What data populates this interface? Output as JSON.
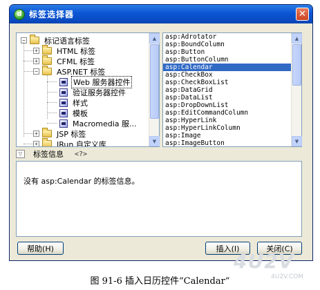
{
  "window": {
    "title": "标签选择器",
    "close_glyph": "✕",
    "app_icon_glyph": "d"
  },
  "tree": {
    "root_label": "标记语言标签",
    "nodes": [
      {
        "label": "HTML 标签",
        "expander": "+"
      },
      {
        "label": "CFML 标签",
        "expander": "+"
      },
      {
        "label": "ASP.NET 标签",
        "expander": "−"
      },
      {
        "label": "Web 服务器控件",
        "selected": true
      },
      {
        "label": "验证服务器控件"
      },
      {
        "label": "样式"
      },
      {
        "label": "模板"
      },
      {
        "label": "Macromedia 服..."
      },
      {
        "label": "JSP 标签",
        "expander": "+"
      },
      {
        "label": "JRun 自定义库",
        "expander": "+"
      }
    ]
  },
  "tag_list": {
    "items": [
      "asp:Adrotator",
      "asp:BoundColumn",
      "asp:Button",
      "asp:ButtonColumn",
      "asp:Calendar",
      "asp:CheckBox",
      "asp:CheckBoxList",
      "asp:DataGrid",
      "asp:DataList",
      "asp:DropDownList",
      "asp:EditCommandColumn",
      "asp:HyperLink",
      "asp:HyperLinkColumn",
      "asp:Image",
      "asp:ImageButton"
    ],
    "selected": "asp:Calendar"
  },
  "tag_info": {
    "header_label": "标签信息",
    "message": "没有 asp:Calendar 的标签信息。"
  },
  "buttons": {
    "help": "帮助(H)",
    "insert": "插入(I)",
    "close": "关闭(C)"
  },
  "caption": "图 91-6    插入日历控件“Calendar”",
  "watermark": {
    "main": "4U2V",
    "sub": "4U2V.COM"
  },
  "colors": {
    "titlebar": "#0b55d4",
    "selection": "#316ac5",
    "dialog_bg": "#ece9d8"
  }
}
